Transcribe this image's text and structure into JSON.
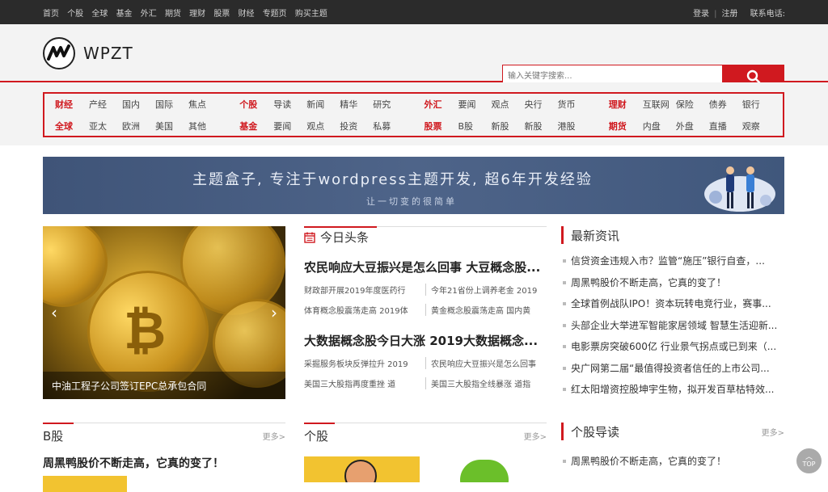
{
  "topbar": {
    "nav": [
      "首页",
      "个股",
      "全球",
      "基金",
      "外汇",
      "期货",
      "理财",
      "股票",
      "财经",
      "专题页",
      "购买主题"
    ],
    "login": "登录",
    "register": "注册",
    "contact": "联系电话:"
  },
  "brand": {
    "name": "WPZT",
    "accent": "#d0191f"
  },
  "search": {
    "placeholder": "输入关键字搜索..."
  },
  "categories": [
    {
      "rows": [
        [
          "财经",
          "产经",
          "国内",
          "国际",
          "焦点"
        ],
        [
          "全球",
          "亚太",
          "欧洲",
          "美国",
          "其他"
        ]
      ]
    },
    {
      "rows": [
        [
          "个股",
          "导读",
          "新闻",
          "精华",
          "研究"
        ],
        [
          "基金",
          "要闻",
          "观点",
          "投资",
          "私募"
        ]
      ]
    },
    {
      "rows": [
        [
          "外汇",
          "要闻",
          "观点",
          "央行",
          "货币"
        ],
        [
          "股票",
          "B股",
          "新股",
          "新股",
          "港股"
        ]
      ]
    },
    {
      "rows": [
        [
          "理财",
          "互联网",
          "保险",
          "债券",
          "银行"
        ],
        [
          "期货",
          "内盘",
          "外盘",
          "直播",
          "观察"
        ]
      ]
    }
  ],
  "banner": {
    "title": "主题盒子, 专注于wordpress主题开发, 超6年开发经验",
    "subtitle": "让一切变的很简单"
  },
  "slider": {
    "caption": "中油工程子公司签订EPC总承包合同"
  },
  "today": {
    "heading": "今日头条",
    "headline1": "农民响应大豆振兴是怎么回事 大豆概念股...",
    "links1": [
      [
        "财政部开展2019年度医药行",
        "今年21省份上调养老金 2019"
      ],
      [
        "体育概念股震荡走高 2019体",
        "黄金概念股震荡走高 国内黄"
      ]
    ],
    "headline2": "大数据概念股今日大涨 2019大数据概念...",
    "links2": [
      [
        "采掘服务板块反弹拉升 2019",
        "农民响应大豆振兴是怎么回事"
      ],
      [
        "美国三大股指再度重挫 道",
        "美国三大股指全线暴涨 道指"
      ]
    ]
  },
  "news": {
    "heading": "最新资讯",
    "items": [
      "信贷资金违规入市？监管“施压”银行自查，...",
      "周黑鸭股价不断走高，它真的变了！",
      "全球首例战队IPO！资本玩转电竞行业，赛事...",
      "头部企业大举进军智能家居领域 智慧生活迎新...",
      "电影票房突破600亿 行业景气拐点或已到来（...",
      "央广网第二届“最值得投资者信任的上市公司...",
      "红太阳增资控股坤宇生物，拟开发百草枯特效..."
    ]
  },
  "bsection": {
    "heading": "B股",
    "more": "更多>",
    "headline": "周黑鸭股价不断走高，它真的变了！"
  },
  "gsection": {
    "heading": "个股",
    "more": "更多>"
  },
  "guide": {
    "heading": "个股导读",
    "more": "更多>",
    "item": "周黑鸭股价不断走高，它真的变了！"
  },
  "totop": "TOP"
}
